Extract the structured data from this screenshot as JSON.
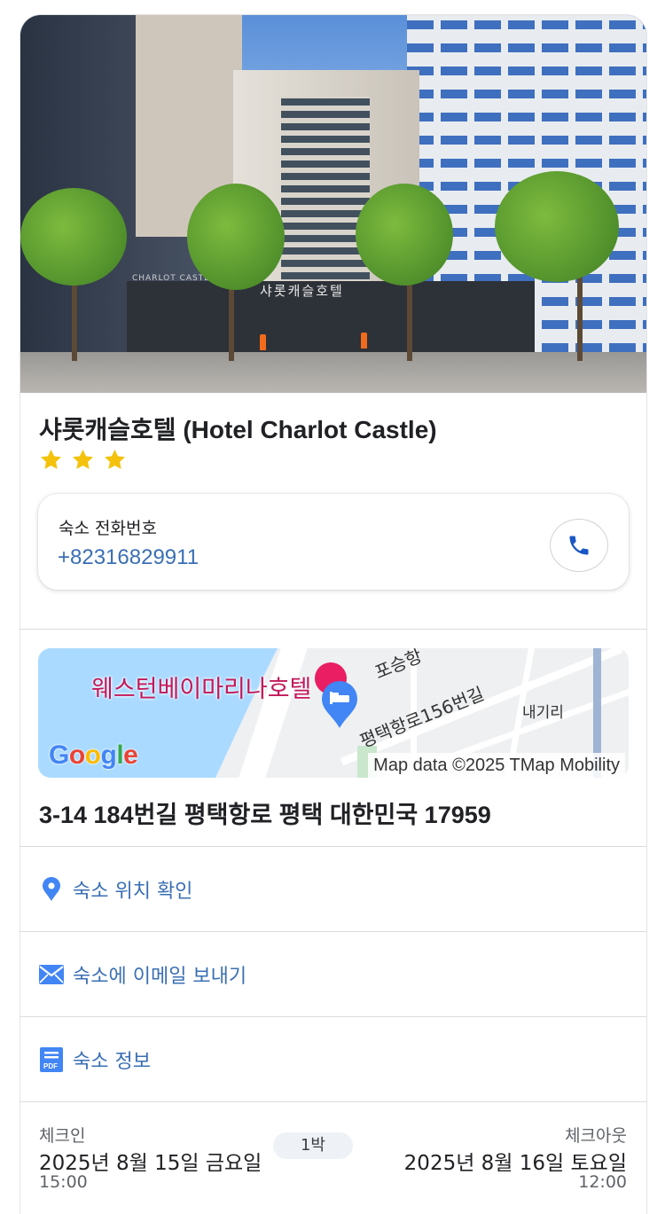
{
  "hotel": {
    "name": "샤롯캐슬호텔 (Hotel Charlot Castle)",
    "star_rating": 3,
    "photo_sign_korean": "샤롯캐슬호텔",
    "photo_sign_english": "CHARLOT CASTLE HOTEL"
  },
  "phone": {
    "label": "숙소 전화번호",
    "number": "+82316829911",
    "call_icon": "phone-icon"
  },
  "map": {
    "hotel_label": "웨스턴베이마리나호텔",
    "road_label_1": "평택항로156번길",
    "road_label_2": "포승항",
    "area_label": "내기리",
    "logo": "Google",
    "credit": "Map data ©2025 TMap Mobility"
  },
  "address": "3-14 184번길 평택항로 평택 대한민국 17959",
  "actions": [
    {
      "label": "숙소 위치 확인",
      "icon": "location-pin-icon"
    },
    {
      "label": "숙소에 이메일 보내기",
      "icon": "email-icon"
    },
    {
      "label": "숙소 정보",
      "icon": "pdf-icon"
    }
  ],
  "stay": {
    "checkin_label": "체크인",
    "checkin_date": "2025년 8월 15일 금요일",
    "checkin_time": "15:00",
    "nights": "1박",
    "checkout_label": "체크아웃",
    "checkout_date": "2025년 8월 16일 토요일",
    "checkout_time": "12:00"
  },
  "colors": {
    "link_blue": "#3a6fb4",
    "star_gold": "#f4c20d",
    "map_water": "#aadaff",
    "hotel_pin": "#e91e63",
    "place_pin": "#4285f4"
  }
}
